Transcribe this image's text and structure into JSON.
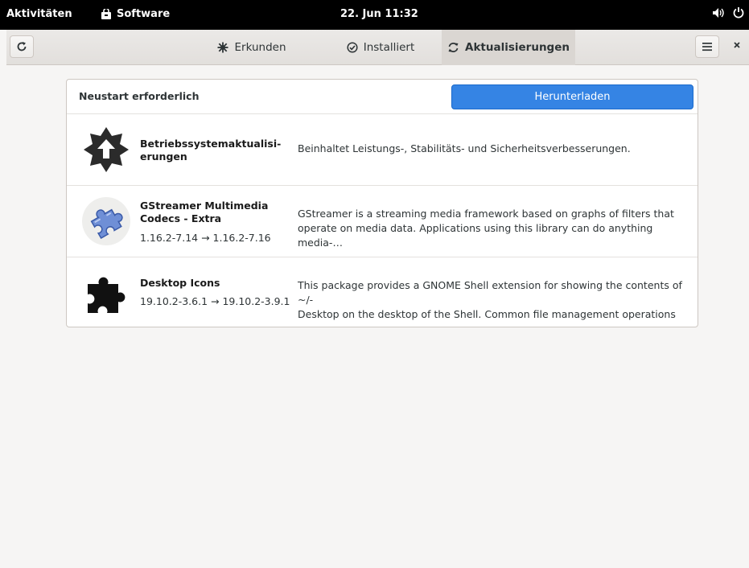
{
  "topbar": {
    "activities": "Aktivitäten",
    "app_name": "Software",
    "clock": "22. Jun 11:32"
  },
  "tabs": [
    {
      "label": "Erkunden",
      "icon": "explore-icon"
    },
    {
      "label": "Installiert",
      "icon": "check-icon"
    },
    {
      "label": "Aktualisierungen",
      "icon": "refresh-icon",
      "active": true
    }
  ],
  "panel": {
    "title": "Neustart erforderlich",
    "download_label": "Herunterladen",
    "accent": "#3584e4"
  },
  "updates": [
    {
      "name_line1": "Betriebssystemaktualisi-",
      "name_line2": "erungen",
      "version": "",
      "desc_line1": "Beinhaltet Leistungs-, Stabilitäts- und Sicherheitsverbesserungen.",
      "desc_line2": ""
    },
    {
      "name_line1": "GStreamer Multimedia",
      "name_line2": "Codecs - Extra",
      "version": "1.16.2-7.14 → 1.16.2-7.16",
      "desc_line1": "GStreamer is a streaming media framework based on graphs of filters that",
      "desc_line2": "operate on media data. Applications using this library can do anything media-…"
    },
    {
      "name_line1": "Desktop Icons",
      "name_line2": "",
      "version": "19.10.2-3.6.1 → 19.10.2-3.9.1",
      "desc_line1": "This package provides a GNOME Shell extension for showing the contents of ~/-",
      "desc_line2": "Desktop on the desktop of the Shell. Common file management operations su…"
    }
  ]
}
